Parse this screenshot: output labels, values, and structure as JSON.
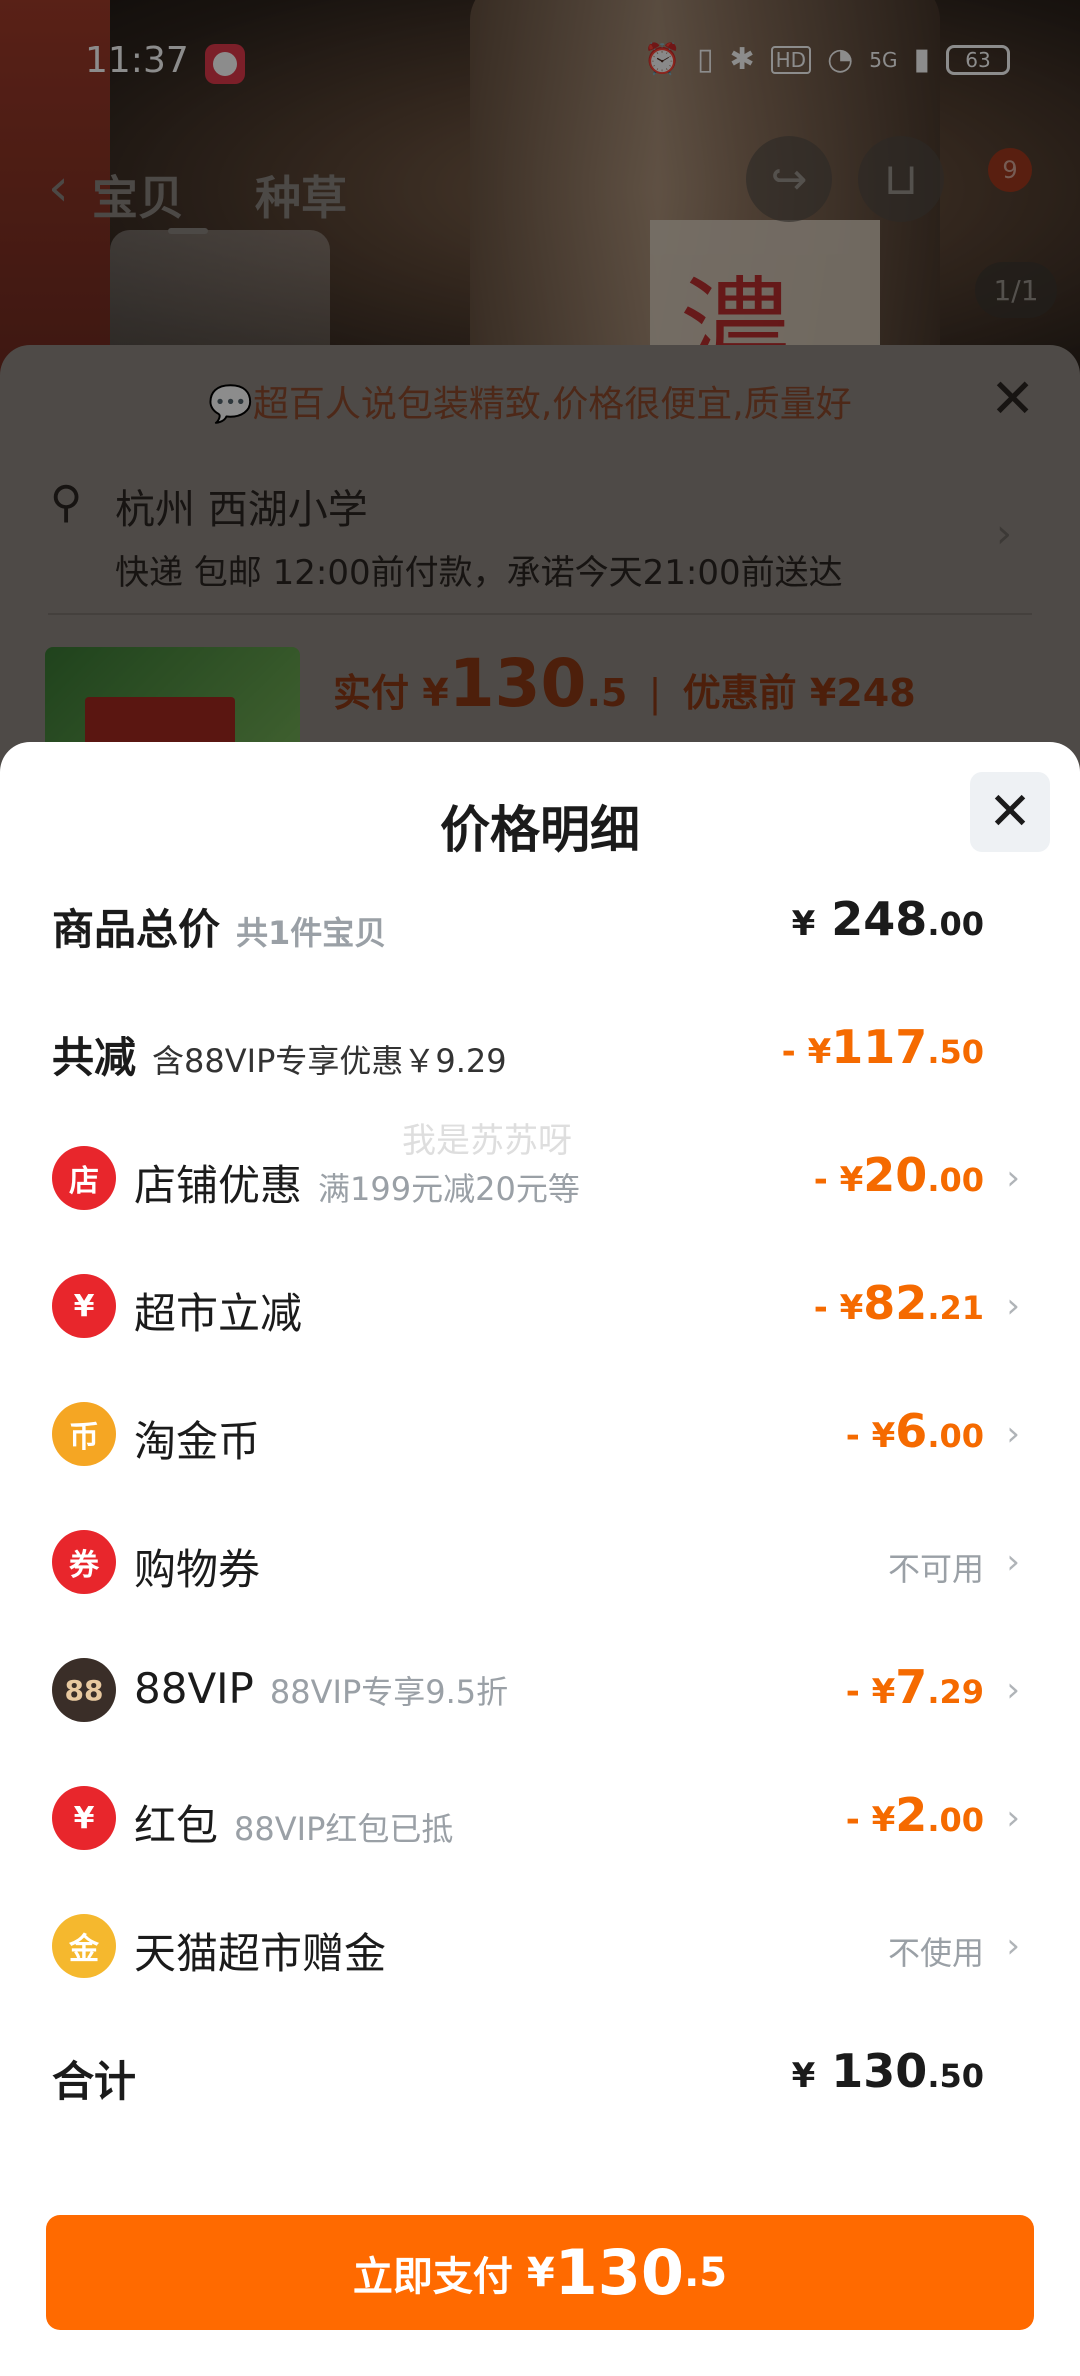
{
  "status_bar": {
    "time": "11:37",
    "battery": "63",
    "network": "5G",
    "hd": "HD"
  },
  "header": {
    "tab_product": "宝贝",
    "tab_grass": "种草",
    "cart_badge": "9",
    "image_counter": "1/1"
  },
  "background_sheet": {
    "tip": "超百人说包装精致,价格很便宜,质量好",
    "address": "杭州 西湖小学",
    "delivery": "快递 包邮 12:00前付款，承诺今天21:00前送达",
    "pay_label": "实付",
    "pay_currency": "¥",
    "pay_int": "130",
    "pay_dec": ".5",
    "before_label": "优惠前",
    "before_amount": "¥248"
  },
  "price_sheet": {
    "title": "价格明细",
    "total": {
      "label": "商品总价",
      "sub": "共1件宝贝",
      "currency": "¥",
      "int": "248",
      "dec": ".00"
    },
    "reduce": {
      "label": "共减",
      "sub": "含88VIP专享优惠￥9.29",
      "prefix": "- ¥",
      "int": "117",
      "dec": ".50"
    },
    "items": [
      {
        "label": "店铺优惠",
        "sub": "满199元减20元等",
        "prefix": "- ¥",
        "int": "20",
        "dec": ".00",
        "icon": "shop-icon",
        "icon_color": "#e8262c",
        "glyph": "店"
      },
      {
        "label": "超市立减",
        "sub": "",
        "prefix": "- ¥",
        "int": "82",
        "dec": ".21",
        "icon": "yuan-icon",
        "icon_color": "#e8262c",
        "glyph": "¥"
      },
      {
        "label": "淘金币",
        "sub": "",
        "prefix": "- ¥",
        "int": "6",
        "dec": ".00",
        "icon": "coin-icon",
        "icon_color": "#f5a623",
        "glyph": "币"
      },
      {
        "label": "购物券",
        "sub": "",
        "status": "不可用",
        "icon": "coupon-icon",
        "icon_color": "#e8262c",
        "glyph": "券"
      },
      {
        "label": "88VIP",
        "sub": "88VIP专享9.5折",
        "prefix": "- ¥",
        "int": "7",
        "dec": ".29",
        "icon": "vip-icon",
        "icon_color": "#3a2e28",
        "glyph": "88"
      },
      {
        "label": "红包",
        "sub": "88VIP红包已抵",
        "prefix": "- ¥",
        "int": "2",
        "dec": ".00",
        "icon": "red-envelope-icon",
        "icon_color": "#e8262c",
        "glyph": "¥"
      },
      {
        "label": "天猫超市赠金",
        "sub": "",
        "status": "不使用",
        "icon": "gift-icon",
        "icon_color": "#f5b82e",
        "glyph": "金"
      }
    ],
    "sum": {
      "label": "合计",
      "currency": "¥",
      "int": "130",
      "dec": ".50"
    }
  },
  "pay_button": {
    "label": "立即支付",
    "currency": "¥",
    "int": "130",
    "dec": ".5"
  },
  "watermark": "我是苏苏呀"
}
